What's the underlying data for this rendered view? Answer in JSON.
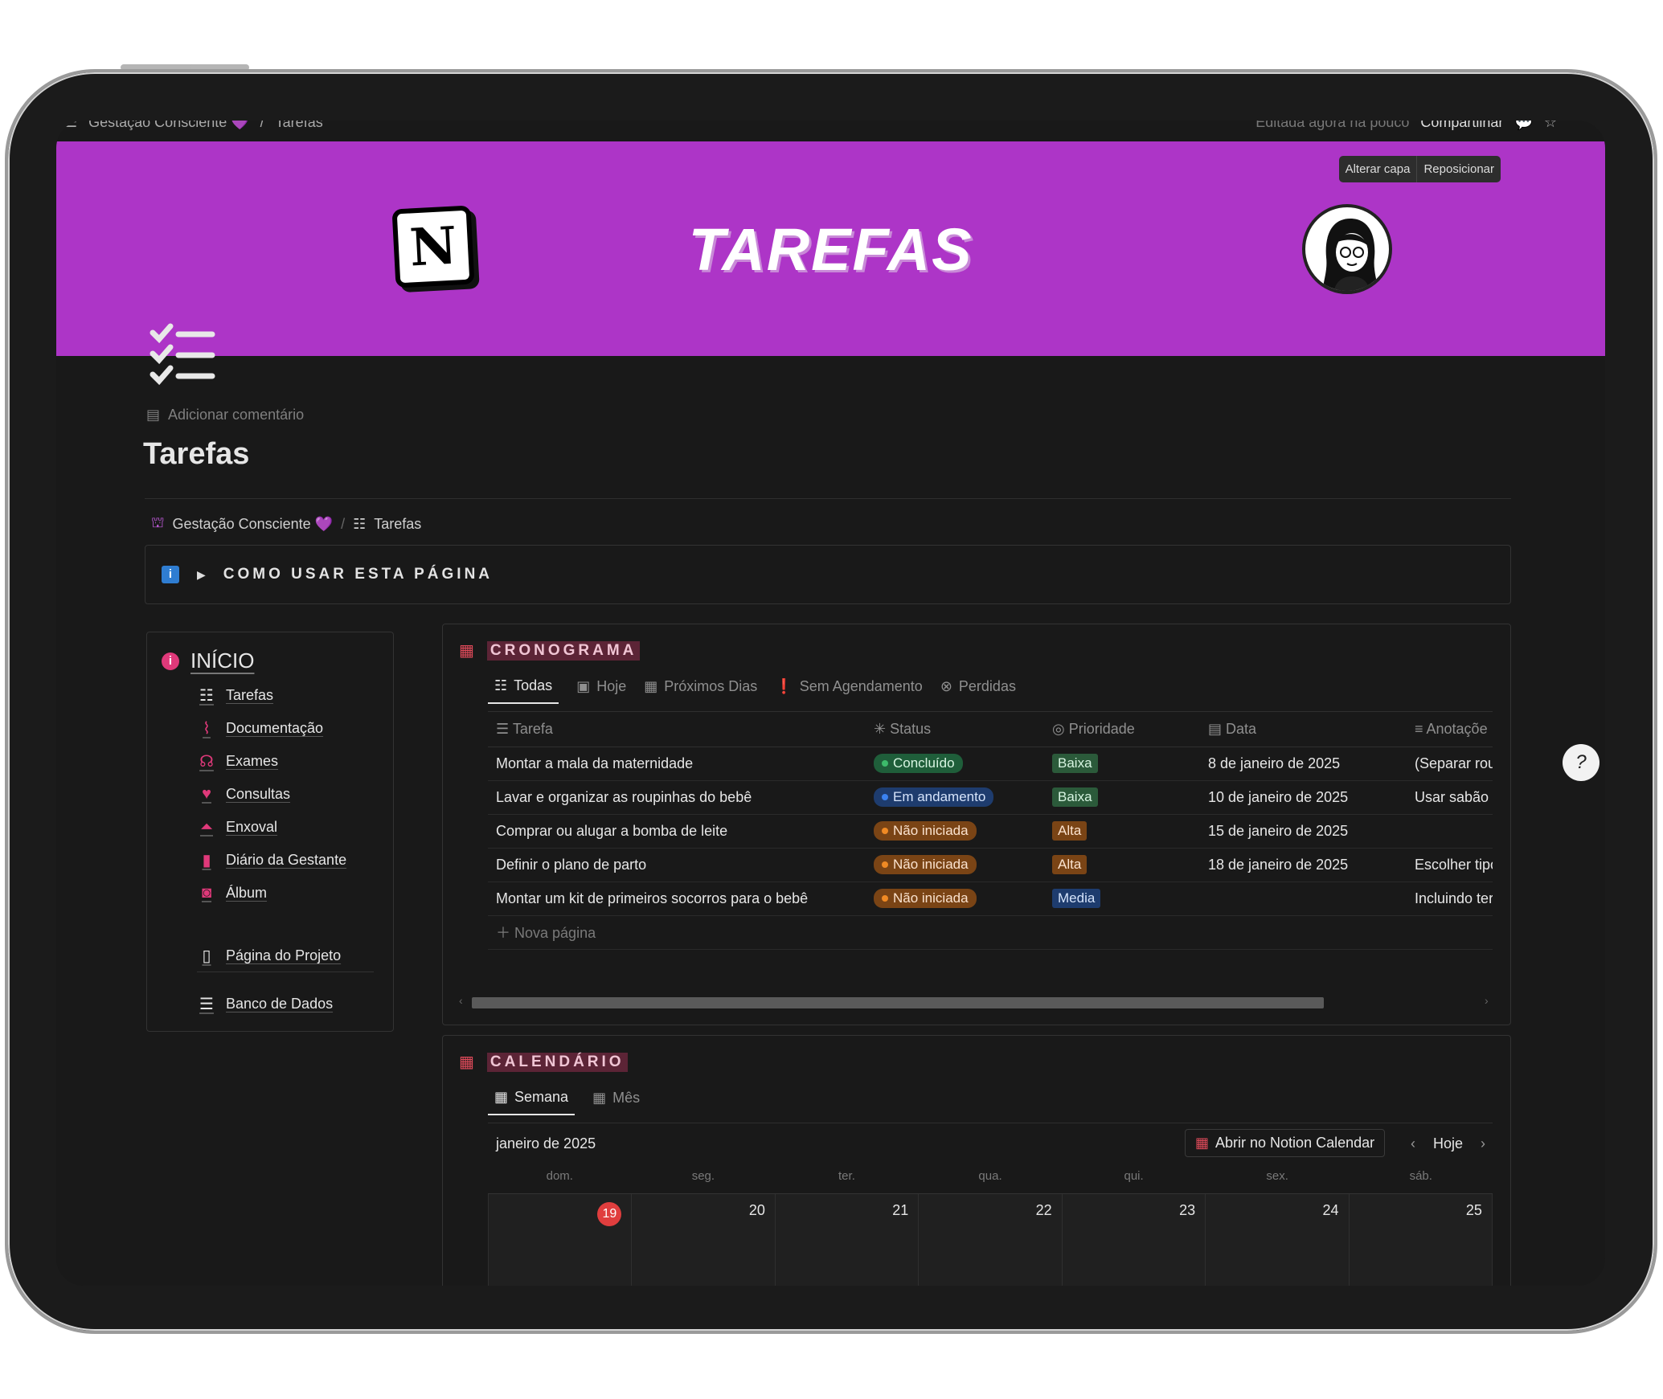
{
  "topbar": {
    "workspace": "Gestação Consciente 💜",
    "page": "Tarefas",
    "edited": "Editada agora há pouco",
    "share": "Compartilhar"
  },
  "cover": {
    "change_cover": "Alterar capa",
    "reposition": "Reposicionar",
    "title": "TAREFAS",
    "logo_letter": "N"
  },
  "page": {
    "add_comment": "Adicionar comentário",
    "title": "Tarefas",
    "breadcrumb": [
      "Gestação Consciente 💜",
      "Tarefas"
    ],
    "callout": "COMO USAR ESTA PÁGINA"
  },
  "sidebar": {
    "heading": "INÍCIO",
    "items": [
      {
        "label": "Tarefas",
        "icon": "checklist-icon"
      },
      {
        "label": "Documentação",
        "icon": "paperclip-icon"
      },
      {
        "label": "Exames",
        "icon": "stethoscope-icon"
      },
      {
        "label": "Consultas",
        "icon": "heartbeat-icon"
      },
      {
        "label": "Enxoval",
        "icon": "hanger-icon"
      },
      {
        "label": "Diário da Gestante",
        "icon": "bookmark-icon"
      },
      {
        "label": "Álbum",
        "icon": "camera-icon"
      },
      {
        "label": "Página do Projeto",
        "icon": "page-icon"
      },
      {
        "label": "Banco de Dados",
        "icon": "database-icon"
      }
    ]
  },
  "cronograma": {
    "title": "CRONOGRAMA",
    "tabs": [
      "Todas",
      "Hoje",
      "Próximos Dias",
      "Sem Agendamento",
      "Perdidas"
    ],
    "columns": [
      "Tarefa",
      "Status",
      "Prioridade",
      "Data",
      "Anotaçõe"
    ],
    "rows": [
      {
        "task": "Montar a mala da maternidade",
        "status": "Concluído",
        "priority": "Baixa",
        "date": "8 de janeiro de 2025",
        "note": "(Separar roup"
      },
      {
        "task": "Lavar e organizar as roupinhas do bebê",
        "status": "Em andamento",
        "priority": "Baixa",
        "date": "10 de janeiro de 2025",
        "note": "Usar sabão n"
      },
      {
        "task": "Comprar ou alugar a bomba de leite",
        "status": "Não iniciada",
        "priority": "Alta",
        "date": "15 de janeiro de 2025",
        "note": ""
      },
      {
        "task": "Definir o plano de parto",
        "status": "Não iniciada",
        "priority": "Alta",
        "date": "18 de janeiro de 2025",
        "note": "Escolher tipo"
      },
      {
        "task": "Montar um kit de primeiros socorros para o bebê",
        "status": "Não iniciada",
        "priority": "Media",
        "date": "",
        "note": "Incluindo ter"
      }
    ],
    "new_page": "Nova página"
  },
  "calendario": {
    "title": "CALENDÁRIO",
    "tabs": [
      "Semana",
      "Mês"
    ],
    "month": "janeiro de 2025",
    "open_button": "Abrir no Notion Calendar",
    "today_button": "Hoje",
    "day_names": [
      "dom.",
      "seg.",
      "ter.",
      "qua.",
      "qui.",
      "sex.",
      "sáb."
    ],
    "days": [
      "19",
      "20",
      "21",
      "22",
      "23",
      "24",
      "25"
    ]
  },
  "colors": {
    "cover": "#ad35c7",
    "status_done": "#1f5e3a",
    "status_progress": "#1e3c6e",
    "status_not_started": "#7a4415",
    "prio_low": "#2b5a3a",
    "prio_high": "#7a4415",
    "prio_medium": "#1e3c6e"
  }
}
